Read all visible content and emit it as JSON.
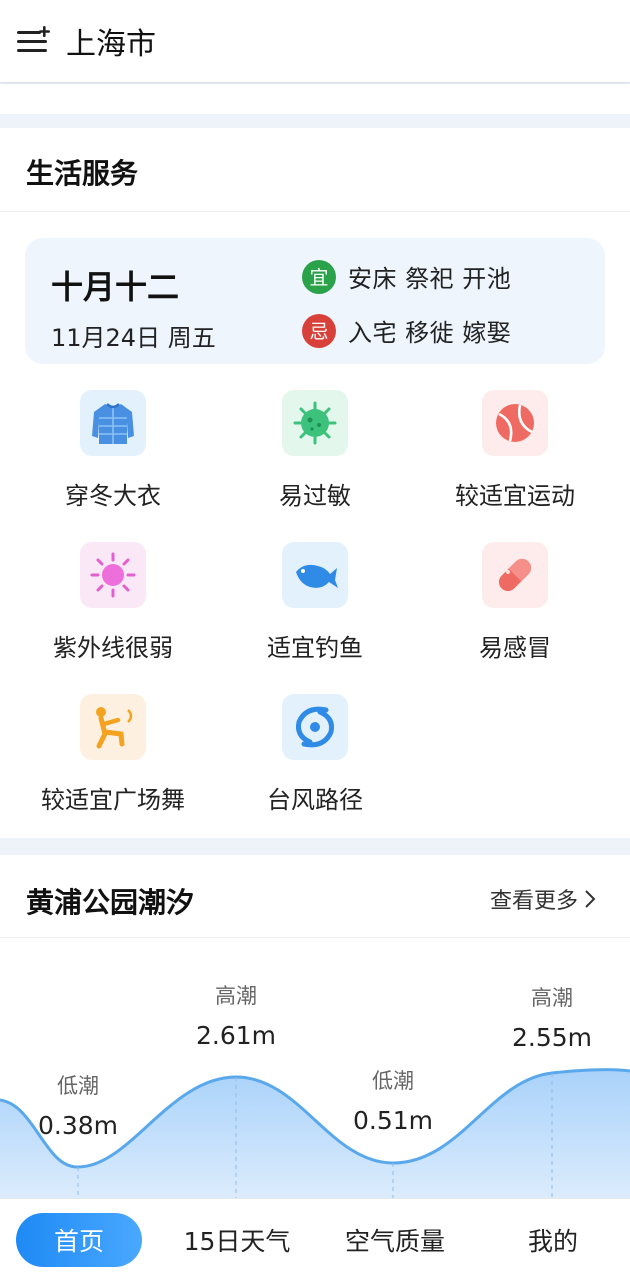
{
  "header": {
    "city": "上海市"
  },
  "life": {
    "title": "生活服务",
    "almanac": {
      "lunar": "十月十二",
      "solar": "11月24日 周五",
      "yi_badge": "宜",
      "yi_text": "安床 祭祀 开池",
      "ji_badge": "忌",
      "ji_text": "入宅 移徙 嫁娶",
      "yi_color": "#2aa24a",
      "ji_color": "#d8413a"
    },
    "items": [
      {
        "label": "穿冬大衣",
        "icon": "coat-icon"
      },
      {
        "label": "易过敏",
        "icon": "allergy-icon"
      },
      {
        "label": "较适宜运动",
        "icon": "sport-ball-icon"
      },
      {
        "label": "紫外线很弱",
        "icon": "sun-icon"
      },
      {
        "label": "适宜钓鱼",
        "icon": "fish-icon"
      },
      {
        "label": "易感冒",
        "icon": "pill-icon"
      },
      {
        "label": "较适宜广场舞",
        "icon": "dance-icon"
      },
      {
        "label": "台风路径",
        "icon": "typhoon-icon"
      }
    ]
  },
  "tide": {
    "title": "黄浦公园潮汐",
    "more": "查看更多",
    "points": [
      {
        "label": "低潮",
        "value": "0.38m"
      },
      {
        "label": "高潮",
        "value": "2.61m"
      },
      {
        "label": "低潮",
        "value": "0.51m"
      },
      {
        "label": "高潮",
        "value": "2.55m"
      }
    ]
  },
  "tabs": [
    {
      "label": "首页",
      "active": true
    },
    {
      "label": "15日天气",
      "active": false
    },
    {
      "label": "空气质量",
      "active": false
    },
    {
      "label": "我的",
      "active": false
    }
  ],
  "colors": {
    "accent": "#1e8af5",
    "tide_line": "#5aa8ec"
  }
}
